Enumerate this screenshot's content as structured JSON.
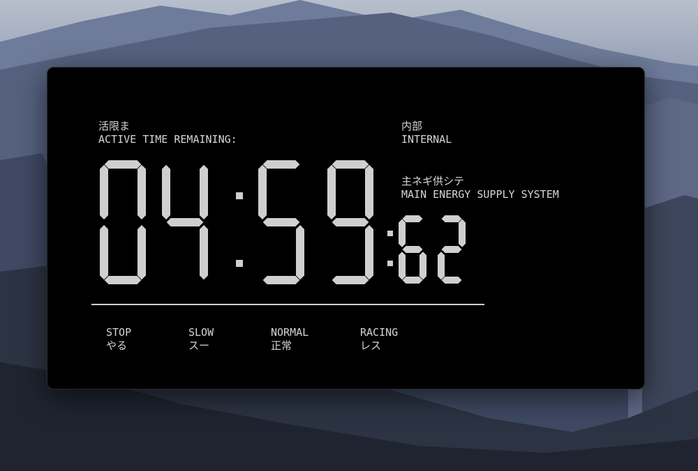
{
  "timer": {
    "label_jp": "活限ま",
    "label_en": "ACTIVE TIME REMAINING:",
    "minutes": "04",
    "seconds": "59",
    "hundredths": "62"
  },
  "power": {
    "source_jp": "内部",
    "source_en": "INTERNAL",
    "system_jp": "主ネギ供シテ",
    "system_en": "MAIN ENERGY SUPPLY SYSTEM"
  },
  "modes": [
    {
      "en": "STOP",
      "jp": "やる"
    },
    {
      "en": "SLOW",
      "jp": "スー"
    },
    {
      "en": "NORMAL",
      "jp": "正常"
    },
    {
      "en": "RACING",
      "jp": "レス"
    }
  ],
  "colors": {
    "panel": "#000000",
    "segment": "#cfcfcf",
    "text": "#d6d6d6"
  }
}
